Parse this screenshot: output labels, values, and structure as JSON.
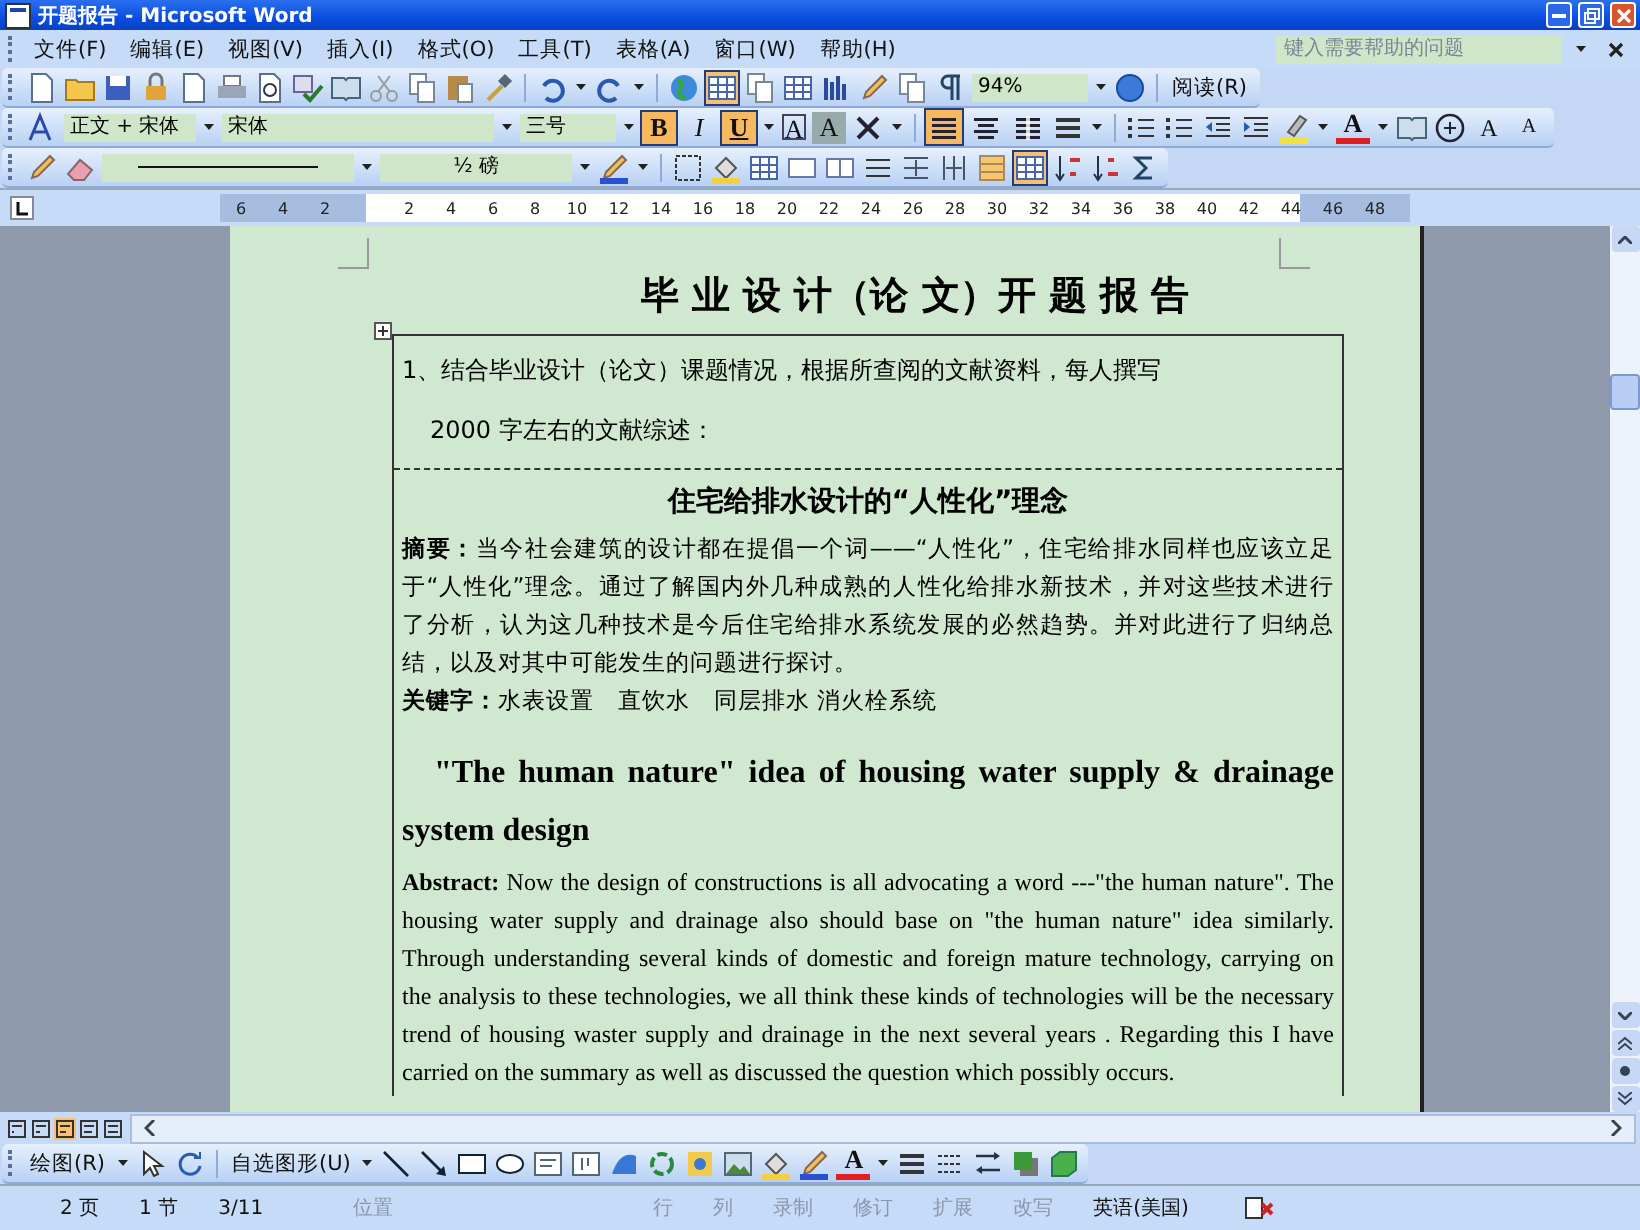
{
  "window": {
    "title": "开题报告 - Microsoft Word"
  },
  "menu": [
    "文件(F)",
    "编辑(E)",
    "视图(V)",
    "插入(I)",
    "格式(O)",
    "工具(T)",
    "表格(A)",
    "窗口(W)",
    "帮助(H)"
  ],
  "help_search": {
    "placeholder": "键入需要帮助的问题"
  },
  "standard_toolbar": {
    "zoom": "94%",
    "reading_button": "阅读(R)"
  },
  "formatting_toolbar": {
    "style": "正文 + 宋体",
    "font": "宋体",
    "size": "三号",
    "format_buttons": [
      {
        "label": "B",
        "selected": true
      },
      {
        "label": "I",
        "selected": false
      },
      {
        "label": "U",
        "selected": true
      }
    ],
    "char_buttons": [
      "A",
      "A"
    ],
    "align_buttons": [
      {
        "kind": "justify",
        "selected": true
      },
      {
        "kind": "center",
        "selected": false
      },
      {
        "kind": "distribute",
        "selected": false
      }
    ],
    "font_color_button": "A",
    "grow_buttons": [
      "A",
      "A"
    ]
  },
  "tables_toolbar": {
    "line_weight": "½ 磅"
  },
  "ruler": {
    "left_labels": [
      "6",
      "4",
      "2"
    ],
    "right_labels": [
      "2",
      "4",
      "6",
      "8",
      "10",
      "12",
      "14",
      "16",
      "18",
      "20",
      "22",
      "24",
      "26",
      "28",
      "30",
      "32",
      "34",
      "36",
      "38",
      "40",
      "42",
      "44",
      "46",
      "48"
    ]
  },
  "document": {
    "title": "毕 业 设 计（论 文）开 题 报 告",
    "prompt_lines": [
      "1、结合毕业设计（论文）课题情况，根据所查阅的文献资料，每人撰写",
      "2000 字左右的文献综述："
    ],
    "heading_zh": "住宅给排水设计的“人性化”理念",
    "abstract_zh": "**摘要：**当今社会建筑的设计都在提倡一个词——“人性化”，住宅给排水同样也应该立足于“人性化”理念。通过了解国内外几种成熟的人性化给排水新技术，并对这些技术进行了分析，认为这几种技术是今后住宅给排水系统发展的必然趋势。并对此进行了归纳总结，以及对其中可能发生的问题进行探讨。",
    "keywords_zh": "**关键字：**水表设置　直饮水　同层排水 消火栓系统",
    "heading_en": "\"The human nature\" idea of housing water supply & drainage system design",
    "abstract_en": "**Abstract:** Now the design of constructions is all advocating a word ---\"the human nature\". The housing water supply and drainage also should base on \"the human nature\" idea similarly. Through understanding several kinds of domestic and foreign mature technology, carrying on the analysis to these technologies, we all think these kinds of technologies will be the necessary trend of housing waster supply and drainage in the next several years . Regarding this I have carried on the summary as well as discussed the question which possibly occurs."
  },
  "drawing_toolbar": {
    "draw_menu": "绘图(R)",
    "autoshapes_menu": "自选图形(U)",
    "font_color_button": "A"
  },
  "status_bar": [
    {
      "text": "2 页",
      "disabled": false
    },
    {
      "text": "1 节",
      "disabled": false
    },
    {
      "text": "3/11",
      "disabled": false
    },
    {
      "text": "位置",
      "disabled": true
    },
    {
      "text": "行",
      "disabled": true
    },
    {
      "text": "列",
      "disabled": true
    },
    {
      "text": "录制",
      "disabled": true
    },
    {
      "text": "修订",
      "disabled": true
    },
    {
      "text": "扩展",
      "disabled": true
    },
    {
      "text": "改写",
      "disabled": true
    },
    {
      "text": "英语(美国)",
      "disabled": false
    }
  ]
}
